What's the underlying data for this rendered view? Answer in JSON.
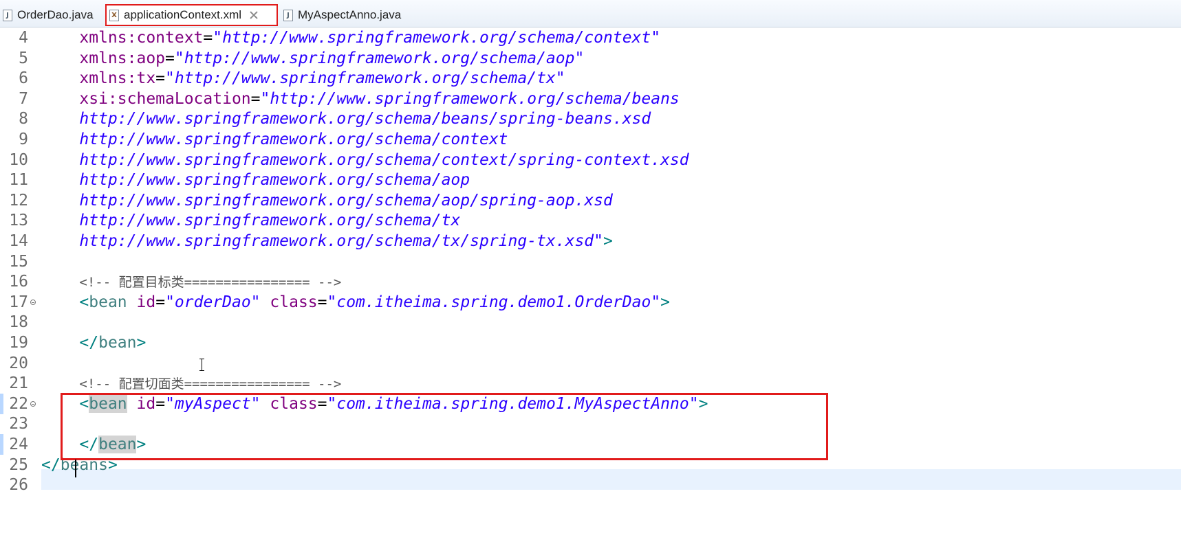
{
  "tabs": [
    {
      "label": "OrderDao.java",
      "icon": "java-file-icon",
      "active": false
    },
    {
      "label": "applicationContext.xml",
      "icon": "xml-file-icon",
      "active": true
    },
    {
      "label": "MyAspectAnno.java",
      "icon": "java-file-icon",
      "active": false
    }
  ],
  "lines": [
    {
      "no": "4",
      "segments": [
        {
          "t": "    ",
          "c": "plain"
        },
        {
          "t": "xmlns:context",
          "c": "attr"
        },
        {
          "t": "=",
          "c": "plain"
        },
        {
          "t": "\"http://www.springframework.org/schema/context\"",
          "c": "str"
        }
      ]
    },
    {
      "no": "5",
      "segments": [
        {
          "t": "    ",
          "c": "plain"
        },
        {
          "t": "xmlns:aop",
          "c": "attr"
        },
        {
          "t": "=",
          "c": "plain"
        },
        {
          "t": "\"http://www.springframework.org/schema/aop\"",
          "c": "str"
        }
      ]
    },
    {
      "no": "6",
      "segments": [
        {
          "t": "    ",
          "c": "plain"
        },
        {
          "t": "xmlns:tx",
          "c": "attr"
        },
        {
          "t": "=",
          "c": "plain"
        },
        {
          "t": "\"http://www.springframework.org/schema/tx\"",
          "c": "str"
        }
      ]
    },
    {
      "no": "7",
      "segments": [
        {
          "t": "    ",
          "c": "plain"
        },
        {
          "t": "xsi:schemaLocation",
          "c": "attr"
        },
        {
          "t": "=",
          "c": "plain"
        },
        {
          "t": "\"http://www.springframework.org/schema/beans",
          "c": "str"
        }
      ]
    },
    {
      "no": "8",
      "segments": [
        {
          "t": "    ",
          "c": "plain"
        },
        {
          "t": "http://www.springframework.org/schema/beans/spring-beans.xsd",
          "c": "str"
        }
      ]
    },
    {
      "no": "9",
      "segments": [
        {
          "t": "    ",
          "c": "plain"
        },
        {
          "t": "http://www.springframework.org/schema/context",
          "c": "str"
        }
      ]
    },
    {
      "no": "10",
      "segments": [
        {
          "t": "    ",
          "c": "plain"
        },
        {
          "t": "http://www.springframework.org/schema/context/spring-context.xsd",
          "c": "str"
        }
      ]
    },
    {
      "no": "11",
      "segments": [
        {
          "t": "    ",
          "c": "plain"
        },
        {
          "t": "http://www.springframework.org/schema/aop",
          "c": "str"
        }
      ]
    },
    {
      "no": "12",
      "segments": [
        {
          "t": "    ",
          "c": "plain"
        },
        {
          "t": "http://www.springframework.org/schema/aop/spring-aop.xsd",
          "c": "str"
        }
      ]
    },
    {
      "no": "13",
      "segments": [
        {
          "t": "    ",
          "c": "plain"
        },
        {
          "t": "http://www.springframework.org/schema/tx",
          "c": "str"
        }
      ]
    },
    {
      "no": "14",
      "segments": [
        {
          "t": "    ",
          "c": "plain"
        },
        {
          "t": "http://www.springframework.org/schema/tx/spring-tx.xsd\"",
          "c": "str"
        },
        {
          "t": ">",
          "c": "bracket"
        }
      ]
    },
    {
      "no": "15",
      "segments": []
    },
    {
      "no": "16",
      "segments": [
        {
          "t": "    ",
          "c": "plain"
        },
        {
          "t": "<!-- 配置目标类================ -->",
          "c": "comment"
        }
      ]
    },
    {
      "no": "17",
      "fold": true,
      "segments": [
        {
          "t": "    ",
          "c": "plain"
        },
        {
          "t": "<",
          "c": "bracket"
        },
        {
          "t": "bean",
          "c": "tag"
        },
        {
          "t": " ",
          "c": "plain"
        },
        {
          "t": "id",
          "c": "attr"
        },
        {
          "t": "=",
          "c": "plain"
        },
        {
          "t": "\"orderDao\"",
          "c": "str"
        },
        {
          "t": " ",
          "c": "plain"
        },
        {
          "t": "class",
          "c": "attr"
        },
        {
          "t": "=",
          "c": "plain"
        },
        {
          "t": "\"com.itheima.spring.demo1.OrderDao\"",
          "c": "str"
        },
        {
          "t": ">",
          "c": "bracket"
        }
      ]
    },
    {
      "no": "18",
      "segments": []
    },
    {
      "no": "19",
      "segments": [
        {
          "t": "    ",
          "c": "plain"
        },
        {
          "t": "</",
          "c": "bracket"
        },
        {
          "t": "bean",
          "c": "tag"
        },
        {
          "t": ">",
          "c": "bracket"
        }
      ]
    },
    {
      "no": "20",
      "segments": []
    },
    {
      "no": "21",
      "segments": [
        {
          "t": "    ",
          "c": "plain"
        },
        {
          "t": "<!-- 配置切面类================ -->",
          "c": "comment"
        }
      ]
    },
    {
      "no": "22",
      "fold": true,
      "marker": true,
      "segments": [
        {
          "t": "    ",
          "c": "plain"
        },
        {
          "t": "<",
          "c": "bracket"
        },
        {
          "t": "bean",
          "c": "tag highlight-word"
        },
        {
          "t": " ",
          "c": "plain"
        },
        {
          "t": "id",
          "c": "attr"
        },
        {
          "t": "=",
          "c": "plain"
        },
        {
          "t": "\"myAspect\"",
          "c": "str"
        },
        {
          "t": " ",
          "c": "plain"
        },
        {
          "t": "class",
          "c": "attr"
        },
        {
          "t": "=",
          "c": "plain"
        },
        {
          "t": "\"com.itheima.spring.demo1.MyAspectAnno\"",
          "c": "str"
        },
        {
          "t": ">",
          "c": "bracket"
        }
      ]
    },
    {
      "no": "23",
      "segments": []
    },
    {
      "no": "24",
      "marker": true,
      "segments": [
        {
          "t": "    ",
          "c": "plain"
        },
        {
          "t": "</",
          "c": "bracket"
        },
        {
          "t": "bean",
          "c": "tag highlight-word"
        },
        {
          "t": ">",
          "c": "bracket"
        }
      ]
    },
    {
      "no": "25",
      "segments": [
        {
          "t": "</",
          "c": "bracket"
        },
        {
          "t": "beans",
          "c": "tag"
        },
        {
          "t": ">",
          "c": "bracket"
        }
      ]
    },
    {
      "no": "26",
      "segments": []
    }
  ]
}
